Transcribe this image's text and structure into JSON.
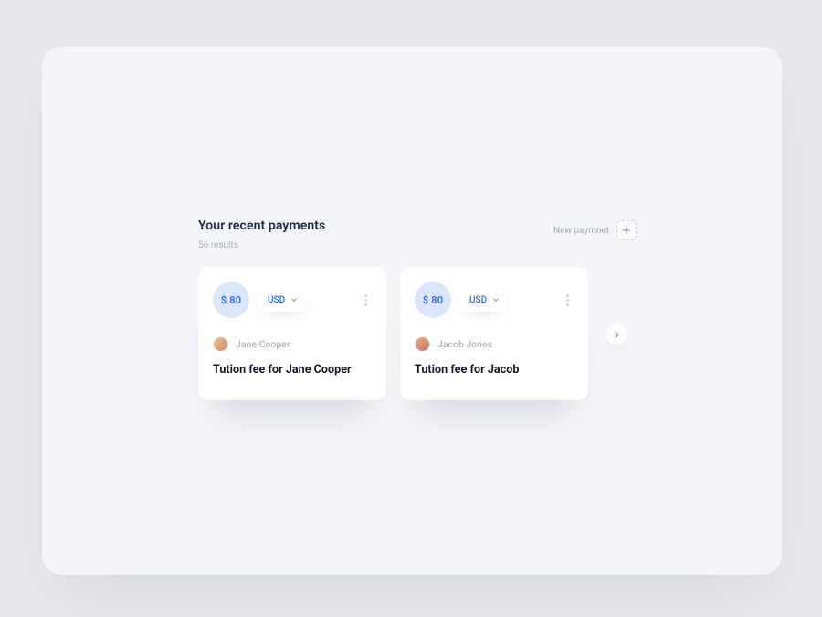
{
  "section": {
    "title": "Your recent payments",
    "results_label": "56 results",
    "new_payment_label": "New paymnet"
  },
  "cards": [
    {
      "amount": "$ 80",
      "currency": "USD",
      "person": "Jane Cooper",
      "title": "Tution fee for Jane Cooper"
    },
    {
      "amount": "$ 80",
      "currency": "USD",
      "person": "Jacob Jones",
      "title": "Tution fee for Jacob"
    }
  ]
}
